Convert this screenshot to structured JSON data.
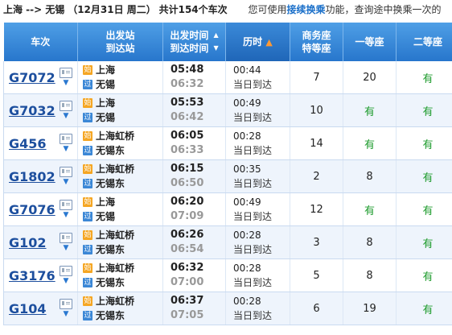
{
  "header": {
    "route": "上海 --> 无锡",
    "date": "（12月31日  周二）",
    "count": "共计154个车次",
    "hint_pre": "您可使用",
    "hint_link": "接续换乘",
    "hint_post": "功能，查询途中换乘一次的"
  },
  "columns": {
    "train": "车次",
    "station_1": "出发站",
    "station_2": "到达站",
    "time_1": "出发时间",
    "time_2": "到达时间",
    "duration": "历时",
    "business_1": "商务座",
    "business_2": "特等座",
    "first": "一等座",
    "second": "二等座"
  },
  "icons": {
    "origin": "始",
    "pass": "过"
  },
  "trains": [
    {
      "no": "G7072",
      "from": "上海",
      "to": "无锡",
      "from_type": "origin",
      "to_type": "pass",
      "dep": "05:48",
      "arr": "06:32",
      "dur": "00:44",
      "arrive": "当日到达",
      "business": "7",
      "first": "20",
      "second": "有"
    },
    {
      "no": "G7032",
      "from": "上海",
      "to": "无锡",
      "from_type": "origin",
      "to_type": "pass",
      "dep": "05:53",
      "arr": "06:42",
      "dur": "00:49",
      "arrive": "当日到达",
      "business": "10",
      "first": "有",
      "second": "有"
    },
    {
      "no": "G456",
      "from": "上海虹桥",
      "to": "无锡东",
      "from_type": "origin",
      "to_type": "pass",
      "dep": "06:05",
      "arr": "06:33",
      "dur": "00:28",
      "arrive": "当日到达",
      "business": "14",
      "first": "有",
      "second": "有"
    },
    {
      "no": "G1802",
      "from": "上海虹桥",
      "to": "无锡东",
      "from_type": "origin",
      "to_type": "pass",
      "dep": "06:15",
      "arr": "06:50",
      "dur": "00:35",
      "arrive": "当日到达",
      "business": "2",
      "first": "8",
      "second": "有"
    },
    {
      "no": "G7076",
      "from": "上海",
      "to": "无锡",
      "from_type": "origin",
      "to_type": "pass",
      "dep": "06:20",
      "arr": "07:09",
      "dur": "00:49",
      "arrive": "当日到达",
      "business": "12",
      "first": "有",
      "second": "有"
    },
    {
      "no": "G102",
      "from": "上海虹桥",
      "to": "无锡东",
      "from_type": "origin",
      "to_type": "pass",
      "dep": "06:26",
      "arr": "06:54",
      "dur": "00:28",
      "arrive": "当日到达",
      "business": "3",
      "first": "8",
      "second": "有"
    },
    {
      "no": "G3176",
      "from": "上海虹桥",
      "to": "无锡东",
      "from_type": "origin",
      "to_type": "pass",
      "dep": "06:32",
      "arr": "07:00",
      "dur": "00:28",
      "arrive": "当日到达",
      "business": "5",
      "first": "8",
      "second": "有"
    },
    {
      "no": "G104",
      "from": "上海虹桥",
      "to": "无锡东",
      "from_type": "origin",
      "to_type": "pass",
      "dep": "06:37",
      "arr": "07:05",
      "dur": "00:28",
      "arrive": "当日到达",
      "business": "6",
      "first": "19",
      "second": "有"
    }
  ]
}
